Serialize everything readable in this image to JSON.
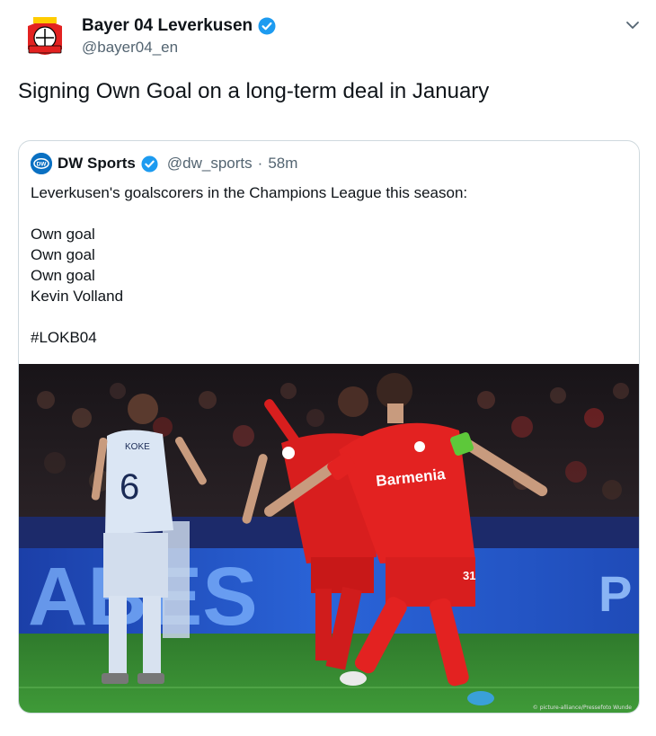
{
  "tweet": {
    "author_name": "Bayer 04 Leverkusen",
    "author_handle": "@bayer04_en",
    "text": "Signing Own Goal on a long-term deal in January",
    "avatar_icon": "bayer-leverkusen-crest-icon",
    "verified_icon": "verified-badge-icon",
    "menu_icon": "chevron-down-icon"
  },
  "quoted": {
    "author_name": "DW Sports",
    "author_handle": "@dw_sports",
    "separator": "·",
    "time": "58m",
    "body_lines": [
      "Leverkusen's goalscorers in the Champions League this season:",
      "",
      "Own goal",
      "Own goal",
      "Own goal",
      "Kevin Volland",
      "",
      "#LOKB04"
    ],
    "photo": {
      "shirt_name": "KOKE",
      "shirt_number": "6",
      "sponsor": "Barmenia",
      "player_number": "31",
      "board_left": "ABES",
      "board_right": "P",
      "credit": "© picture-alliance/Pressefoto Wunde"
    }
  },
  "colors": {
    "verified": "#1d9bf0",
    "leverkusen_red": "#e32221",
    "dw_blue": "#0a70c2",
    "text_secondary": "#536471",
    "border": "#cfd9de"
  }
}
